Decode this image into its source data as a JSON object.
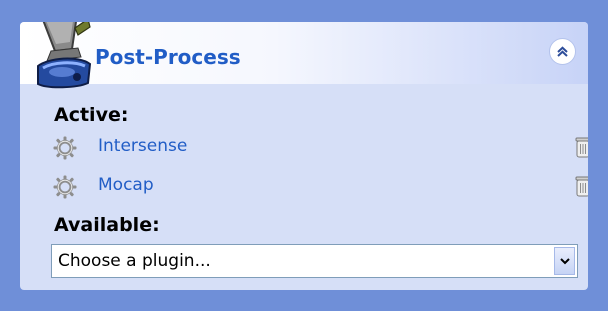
{
  "panel": {
    "title": "Post-Process",
    "collapse_icon": "double-chevron-up-icon",
    "logo_icon": "post-process-machine-icon",
    "active_label": "Active:",
    "active_plugins": [
      {
        "name": "Intersense",
        "icon": "gear-icon",
        "action_icon": "trash-icon"
      },
      {
        "name": "Mocap",
        "icon": "gear-icon",
        "action_icon": "trash-icon"
      }
    ],
    "available_label": "Available:",
    "plugin_select": {
      "value": "Choose a plugin...",
      "icon": "chevron-down-icon"
    }
  },
  "colors": {
    "background": "#6f8fd8",
    "panel_body": "#d6dff7",
    "title_blue": "#215dc6",
    "link_blue": "#215dc6"
  }
}
